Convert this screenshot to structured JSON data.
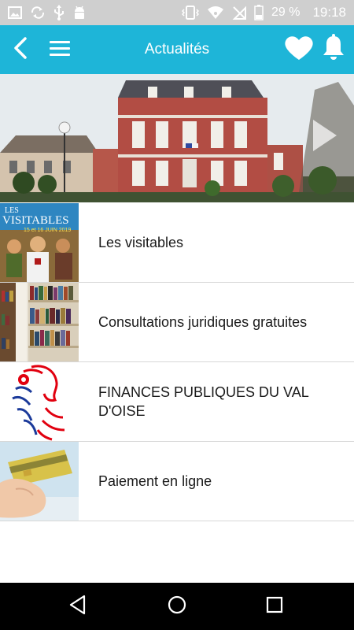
{
  "status_bar": {
    "battery_percent": "29 %",
    "time": "19:18",
    "icons": [
      "image-icon",
      "sync-icon",
      "usb-icon",
      "android-icon",
      "vibrate-icon",
      "wifi-icon",
      "no-sim-icon",
      "battery-icon"
    ]
  },
  "app_bar": {
    "title": "Actualités",
    "color": "#1eb5d8",
    "icons": [
      "back-icon",
      "menu-icon",
      "heart-icon",
      "bell-icon"
    ]
  },
  "hero": {
    "icons": [
      "next-arrow-icon"
    ]
  },
  "news": [
    {
      "label": "Les visitables",
      "thumb_title": "LES",
      "thumb_subtitle": "VISITABLES",
      "thumb_date": "15 et 16 JUIN 2019"
    },
    {
      "label": "Consultations juridiques gratuites"
    },
    {
      "label": "FINANCES PUBLIQUES DU VAL D'OISE"
    },
    {
      "label": "Paiement en ligne"
    }
  ],
  "nav_bar": {
    "icons": [
      "nav-back-icon",
      "nav-home-icon",
      "nav-recents-icon"
    ]
  }
}
